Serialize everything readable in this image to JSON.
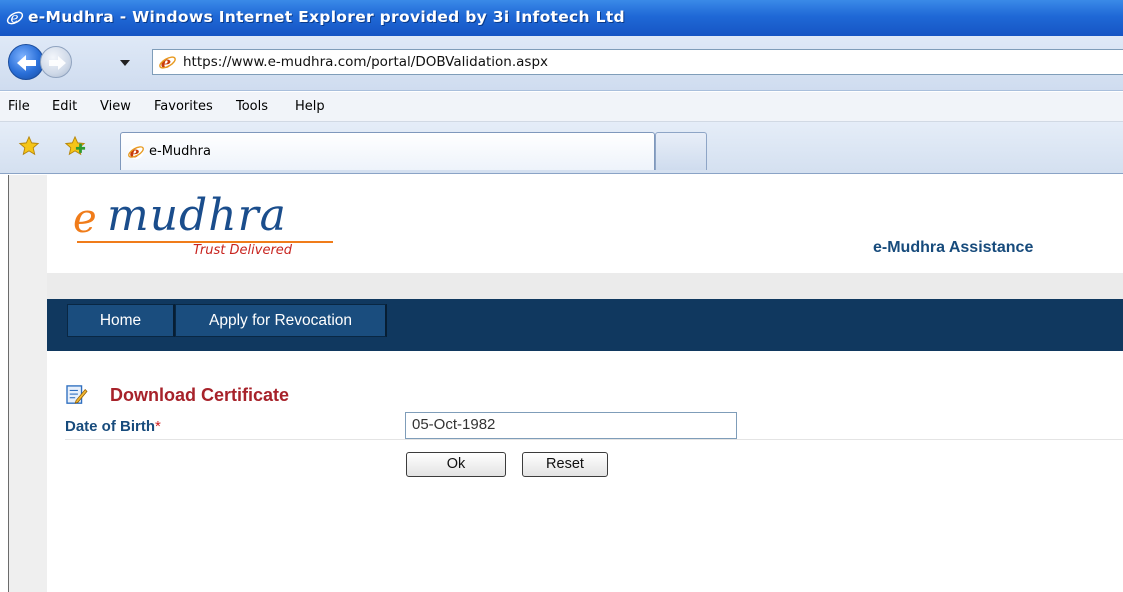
{
  "window": {
    "title": "e-Mudhra - Windows Internet Explorer provided by 3i Infotech Ltd"
  },
  "address_bar": {
    "url": "https://www.e-mudhra.com/portal/DOBValidation.aspx"
  },
  "menu": {
    "items": [
      "File",
      "Edit",
      "View",
      "Favorites",
      "Tools",
      "Help"
    ]
  },
  "tabs": [
    {
      "label": "e-Mudhra"
    }
  ],
  "site": {
    "logo_e": "e",
    "logo_text": "mudhra",
    "tagline": "Trust Delivered",
    "assistance": "e-Mudhra Assistance"
  },
  "nav": {
    "items": [
      "Home",
      "Apply for Revocation"
    ]
  },
  "form": {
    "section_title": "Download Certificate",
    "dob_label": "Date of Birth",
    "required_mark": "*",
    "dob_value": "05-Oct-1982",
    "ok_label": "Ok",
    "reset_label": "Reset"
  },
  "colors": {
    "brand_blue": "#1a4d8c",
    "brand_orange": "#f07c1a",
    "nav_bar": "#10385f",
    "section_title": "#a7222a",
    "label_blue": "#174b7c"
  }
}
